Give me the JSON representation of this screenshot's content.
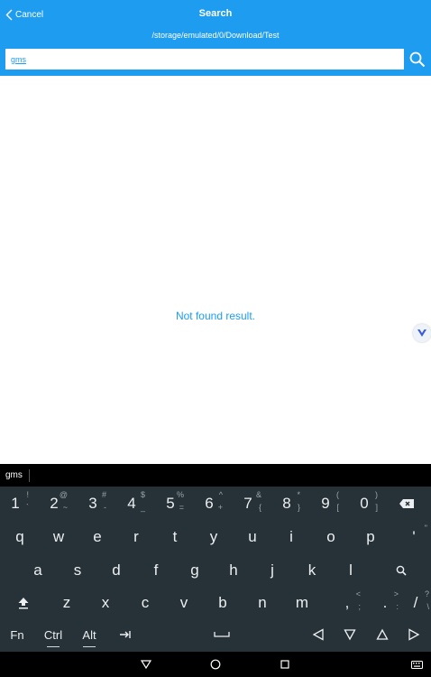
{
  "header": {
    "cancel_label": "Cancel",
    "title": "Search",
    "path": "/storage/emulated/0/Download/Test",
    "search_value": "gms"
  },
  "content": {
    "empty_message": "Not found result."
  },
  "keyboard": {
    "suggestion": "gms",
    "row1": [
      {
        "main": "1",
        "sub": "!"
      },
      {
        "main": "2",
        "sub": "@"
      },
      {
        "main": "3",
        "sub": "#"
      },
      {
        "main": "4",
        "sub": "$"
      },
      {
        "main": "5",
        "sub": "%"
      },
      {
        "main": "6",
        "sub": "^"
      },
      {
        "main": "7",
        "sub": "&"
      },
      {
        "main": "8",
        "sub": "*"
      },
      {
        "main": "9",
        "sub": "("
      },
      {
        "main": "0",
        "sub": ")"
      }
    ],
    "row1_alt": [
      "`",
      "~",
      "-",
      "_",
      "=",
      "+",
      "{",
      "}",
      "[",
      "]"
    ],
    "row2": [
      "q",
      "w",
      "e",
      "r",
      "t",
      "y",
      "u",
      "i",
      "o",
      "p",
      "'"
    ],
    "row2_alt": "\"",
    "row3": [
      "a",
      "s",
      "d",
      "f",
      "g",
      "h",
      "j",
      "k",
      "l"
    ],
    "row4": [
      "z",
      "x",
      "c",
      "v",
      "b",
      "n",
      "m",
      ",",
      ".",
      "/"
    ],
    "row4_sub": {
      "comma_top": "<",
      "comma_bot": ";",
      "period_top": ">",
      "period_bot": ":",
      "slash_top": "?",
      "slash_bot": "\\"
    },
    "row5": {
      "fn": "Fn",
      "ctrl": "Ctrl",
      "alt": "Alt"
    }
  },
  "colors": {
    "accent": "#1e9cf0",
    "keyboard_bg": "#263238"
  }
}
